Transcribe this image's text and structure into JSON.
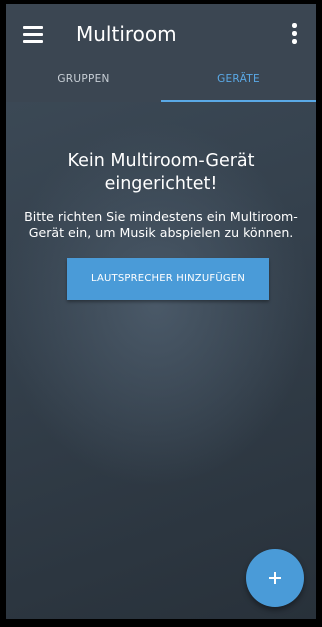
{
  "toolbar": {
    "title": "Multiroom",
    "menu_icon": "hamburger-menu-icon",
    "overflow_icon": "more-vert-icon"
  },
  "tabs": [
    {
      "label": "GRUPPEN",
      "selected": false
    },
    {
      "label": "GERÄTE",
      "selected": true
    }
  ],
  "empty_state": {
    "title_line1": "Kein Multiroom-Gerät",
    "title_line2": "eingerichtet!",
    "description": "Bitte richten Sie mindestens ein Multiroom-Gerät ein, um Musik abspielen zu können.",
    "button_label": "LAUTSPRECHER HINZUFÜGEN"
  },
  "fab": {
    "icon": "plus-icon",
    "label": "+"
  },
  "colors": {
    "appbar": "#3b4652",
    "accent": "#4a9bd8",
    "tab_active": "#5aa9e6",
    "tab_inactive": "#c8cfd6",
    "text": "#ffffff"
  }
}
